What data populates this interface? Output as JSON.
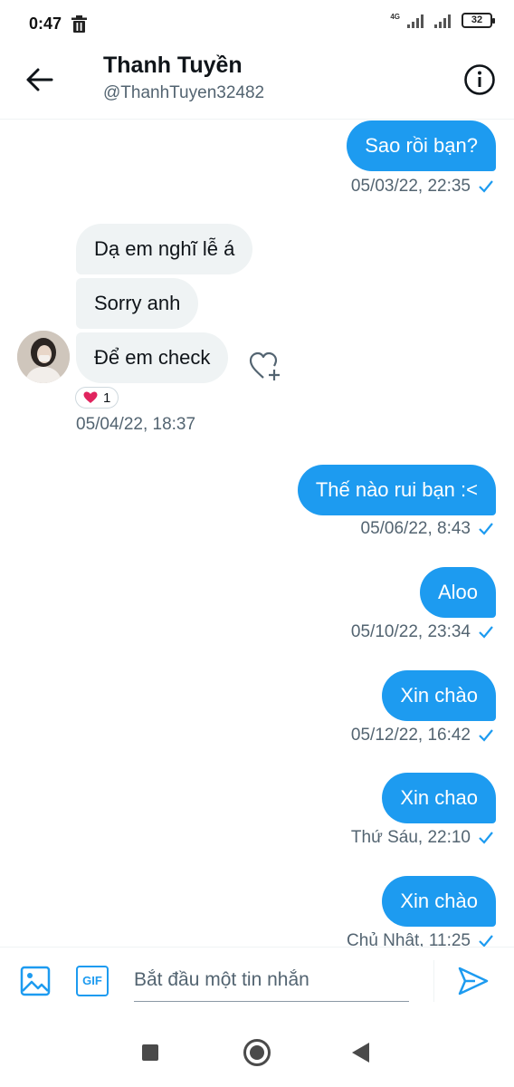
{
  "status_bar": {
    "time": "0:47",
    "network": "4G",
    "battery": "32"
  },
  "header": {
    "name": "Thanh Tuyền",
    "handle": "@ThanhTuyen32482"
  },
  "messages": {
    "m1": {
      "text": "Sao rồi bạn?",
      "time": "05/03/22, 22:35"
    },
    "m2": {
      "text": "Dạ em nghĩ lễ á"
    },
    "m3": {
      "text": "Sorry anh"
    },
    "m4": {
      "text": "Để em check",
      "time": "05/04/22, 18:37",
      "reaction_count": "1"
    },
    "m5": {
      "text": "Thế nào rui bạn :<",
      "time": "05/06/22, 8:43"
    },
    "m6": {
      "text": "Aloo",
      "time": "05/10/22, 23:34"
    },
    "m7": {
      "text": "Xin chào",
      "time": "05/12/22, 16:42"
    },
    "m8": {
      "text": "Xin chao",
      "time": "Thứ Sáu, 22:10"
    },
    "m9": {
      "text": "Xin chào",
      "time": "Chủ Nhật, 11:25"
    }
  },
  "composer": {
    "placeholder": "Bắt đầu một tin nhắn",
    "gif_label": "GIF"
  },
  "colors": {
    "accent": "#1d9bf0",
    "incoming_bubble": "#eff3f4",
    "secondary_text": "#536471"
  },
  "icons": [
    "trash-icon",
    "back-arrow-icon",
    "info-icon",
    "checkmark-icon",
    "heart-add-icon",
    "heart-icon",
    "image-icon",
    "gif-icon",
    "send-icon"
  ]
}
